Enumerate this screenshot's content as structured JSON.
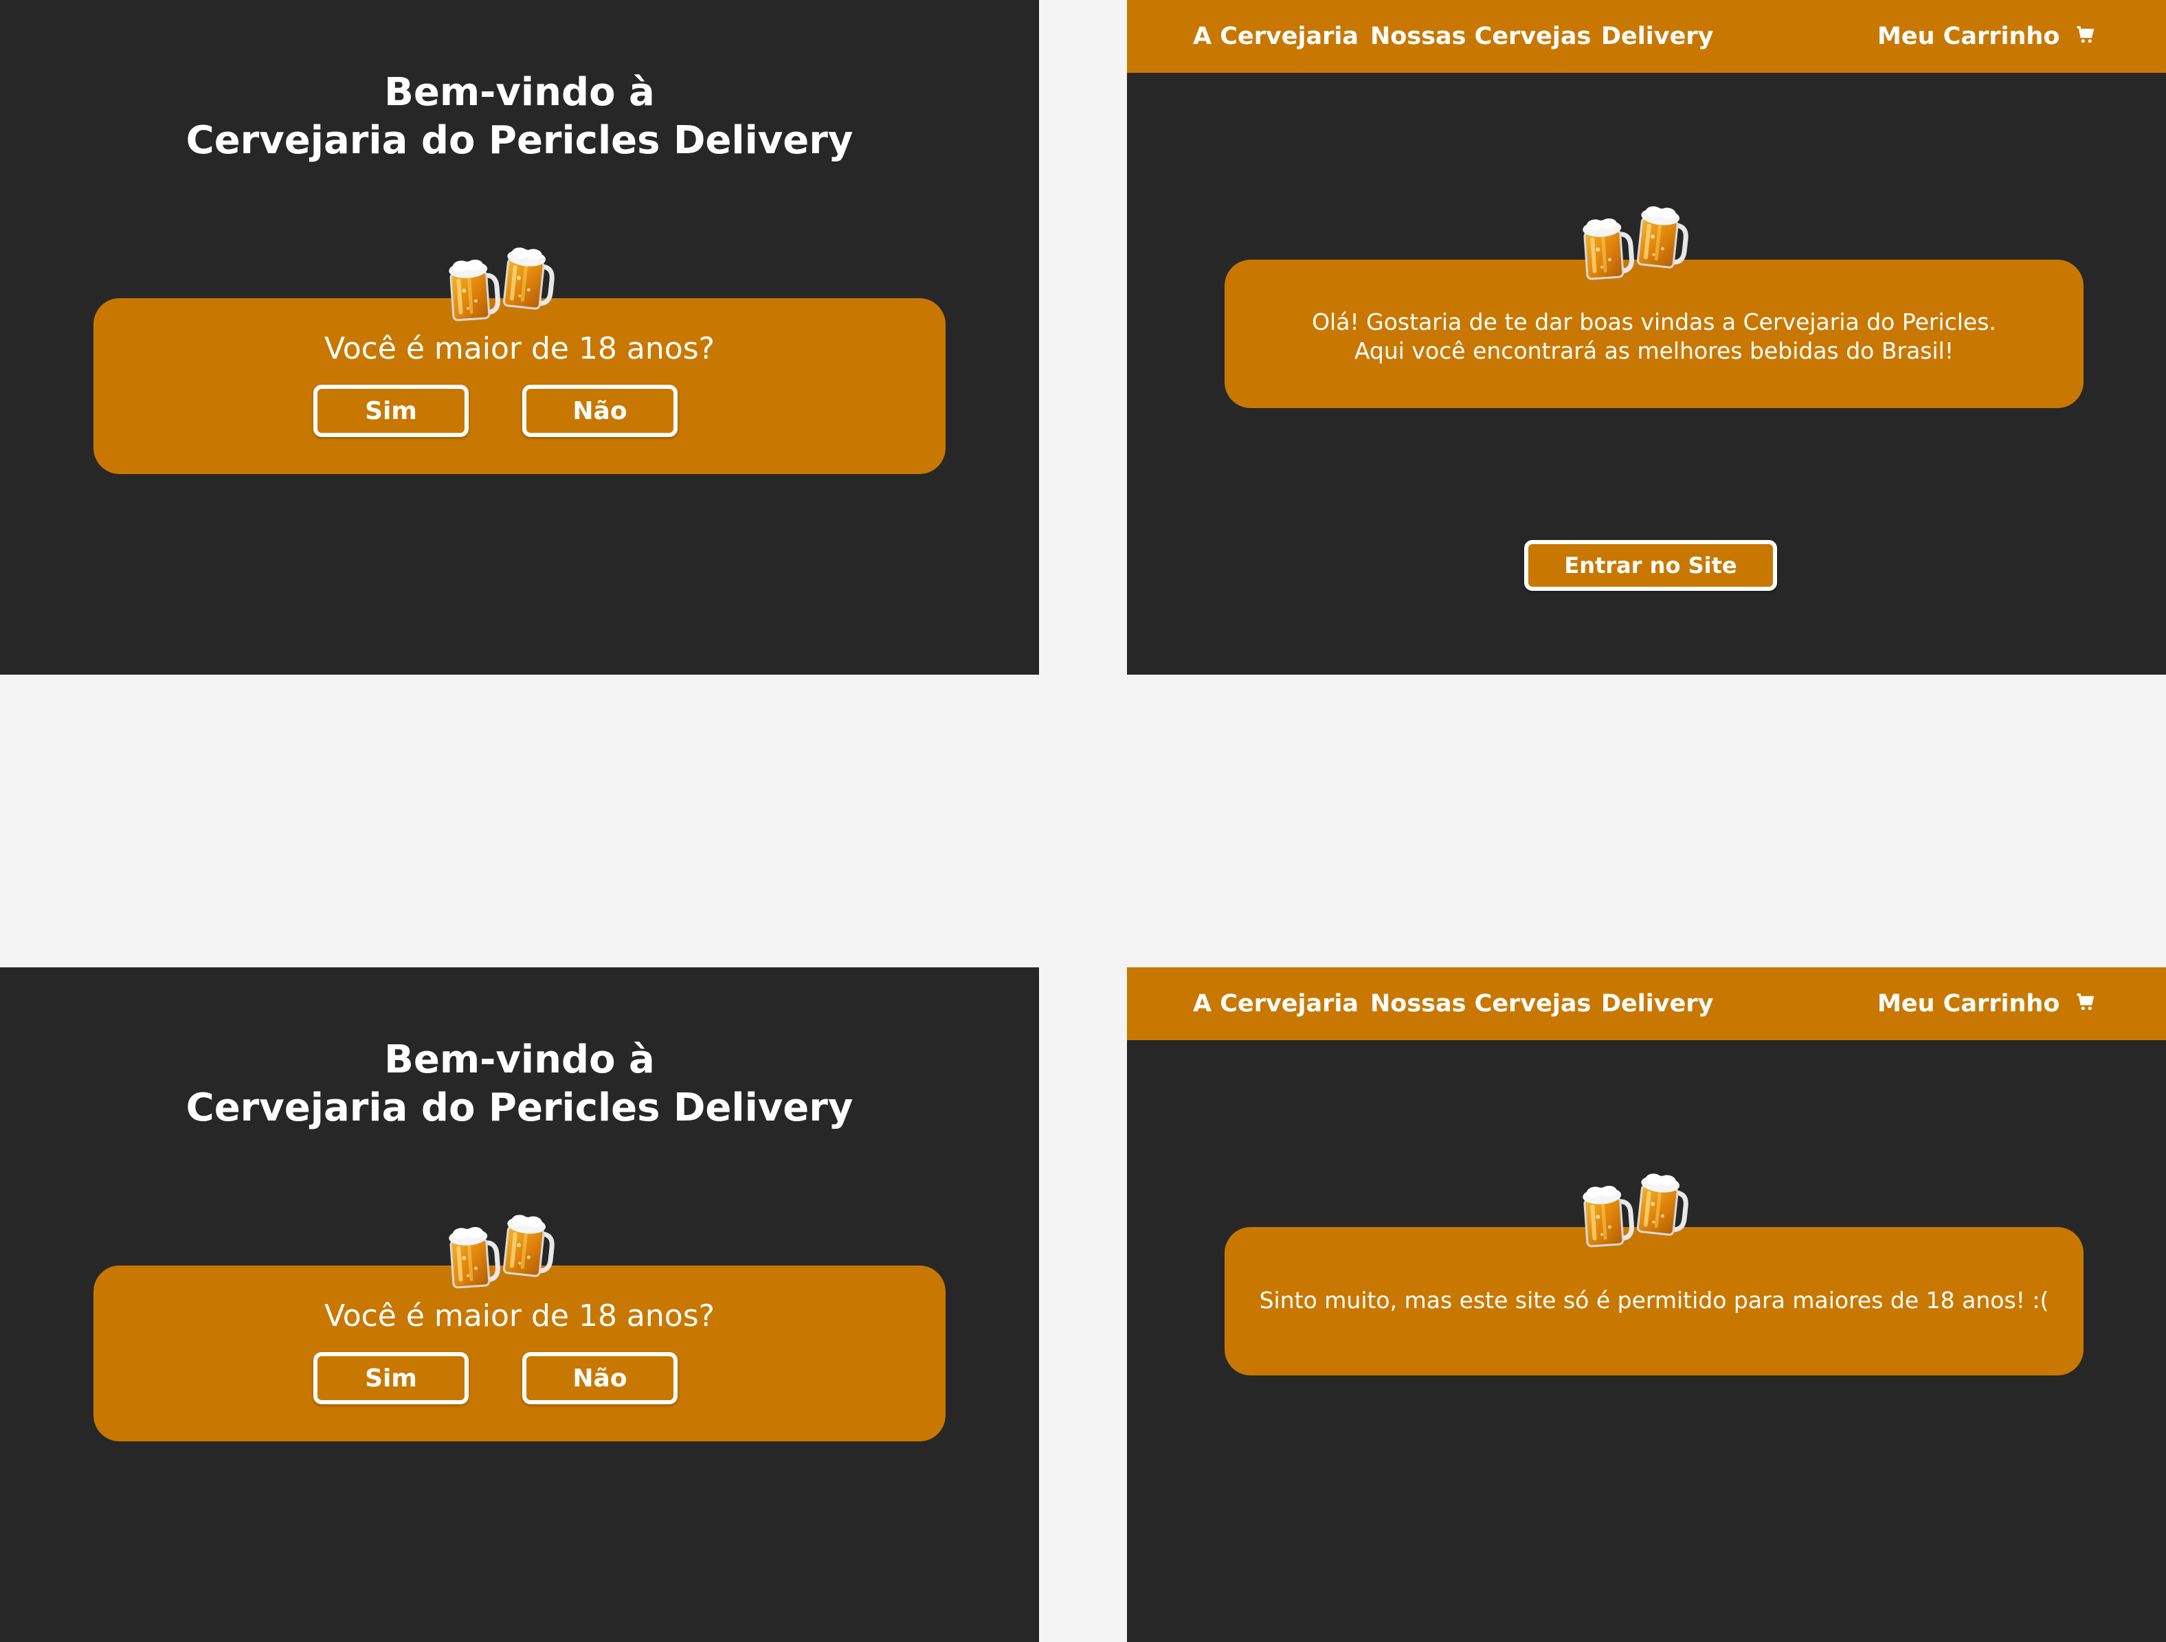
{
  "colors": {
    "page_background": "#f4f4f4",
    "screen_background": "#272727",
    "accent": "#c87800",
    "text": "#ffffff"
  },
  "age_gate": {
    "title_line1": "Bem-vindo à",
    "title_line2": "Cervejaria do Pericles Delivery",
    "question": "Você é maior de 18 anos?",
    "yes_label": "Sim",
    "no_label": "Não",
    "icon": "beer-mugs-icon"
  },
  "nav": {
    "item1": "A Cervejaria",
    "item2": "Nossas Cervejas",
    "item3": "Delivery",
    "cart_label": "Meu Carrinho",
    "cart_icon": "shopping-cart-icon"
  },
  "welcome": {
    "line1": "Olá! Gostaria de te dar boas vindas a Cervejaria do Pericles.",
    "line2": "Aqui você encontrará as melhores bebidas do Brasil!",
    "enter_label": "Entrar no Site"
  },
  "denied": {
    "message": "Sinto muito, mas este site só é permitido para maiores de 18 anos! :("
  }
}
